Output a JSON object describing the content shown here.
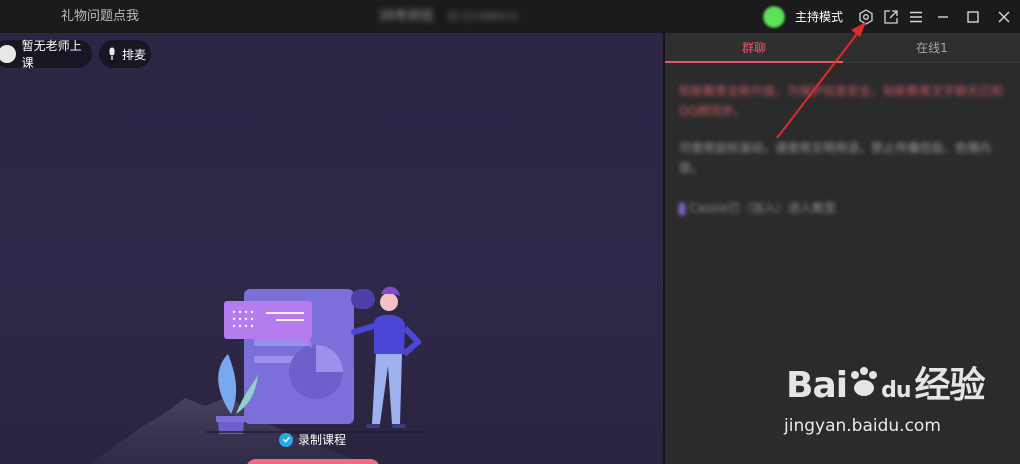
{
  "titlebar": {
    "gift_help": "礼物问题点我",
    "room_name": "38考研班",
    "room_id": "ID:23389551",
    "host_mode": "主持模式",
    "icons": [
      "settings-icon",
      "popout-icon",
      "menu-icon",
      "minimize-icon",
      "maximize-icon",
      "close-icon"
    ]
  },
  "stage": {
    "teacher_status": "暂无老师上课",
    "queue_label": "排麦",
    "record_label": "录制课程"
  },
  "panel": {
    "tabs": [
      {
        "label": "群聊",
        "active": true
      },
      {
        "label": "在线1",
        "active": false
      }
    ],
    "messages": {
      "notice": "知新教育全新升级，为保护信息安全，知新教育文字聊天已和QQ群同步。",
      "tip": "可使用鼠标滚动，请使用文明用语，禁止传播低俗、色情内容。",
      "join": "Cassie已（加入）进入教室"
    }
  },
  "watermark": {
    "brand": "Bai",
    "brand_du": "du",
    "jingyan": "经验",
    "url": "jingyan.baidu.com"
  },
  "colors": {
    "accent": "#e8566e",
    "status_online": "#5ee05a",
    "record_check": "#26a9e8",
    "annotation_arrow": "#e02b2b"
  }
}
